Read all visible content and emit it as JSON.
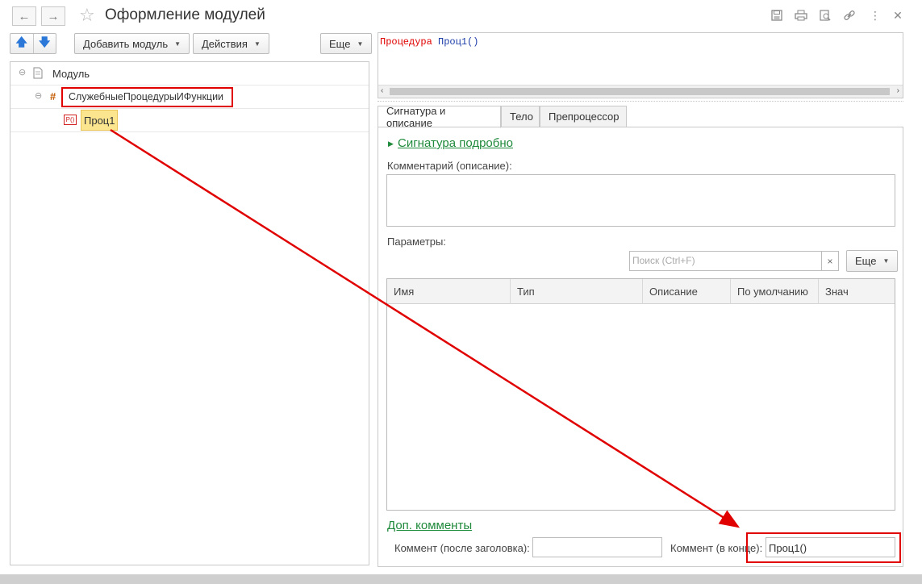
{
  "window": {
    "title": "Оформление модулей",
    "back_icon": "arrow-left-icon",
    "forward_icon": "arrow-right-icon",
    "favorite_icon": "star-icon",
    "actions": [
      "save-icon",
      "print-icon",
      "preview-icon",
      "link-icon",
      "more-icon",
      "close-icon"
    ]
  },
  "toolbar": {
    "add_module_label": "Добавить модуль",
    "actions_label": "Действия",
    "more_label": "Еще"
  },
  "tree": {
    "root_label": "Модуль",
    "group_marker": "#",
    "group_label": "СлужебныеПроцедурыИФункции",
    "proc_icon_text": "P()",
    "proc_label": "Проц1"
  },
  "code": {
    "keyword": "Процедура",
    "name": "Проц1()"
  },
  "tabs": [
    "Сигнатура и описание",
    "Тело",
    "Препроцессор"
  ],
  "signature": {
    "details_link": "Сигнатура подробно",
    "comment_label": "Комментарий (описание):",
    "comment_value": "",
    "params_label": "Параметры:",
    "search_placeholder": "Поиск (Ctrl+F)",
    "search_clear": "×",
    "more_label": "Еще",
    "columns": [
      "Имя",
      "Тип",
      "Описание",
      "По умолчанию",
      "Знач"
    ],
    "extra_comments_link": "Доп. комменты",
    "after_header_label": "Коммент (после заголовка):",
    "after_header_value": "",
    "end_label": "Коммент (в конце):",
    "end_value": "Проц1()"
  }
}
